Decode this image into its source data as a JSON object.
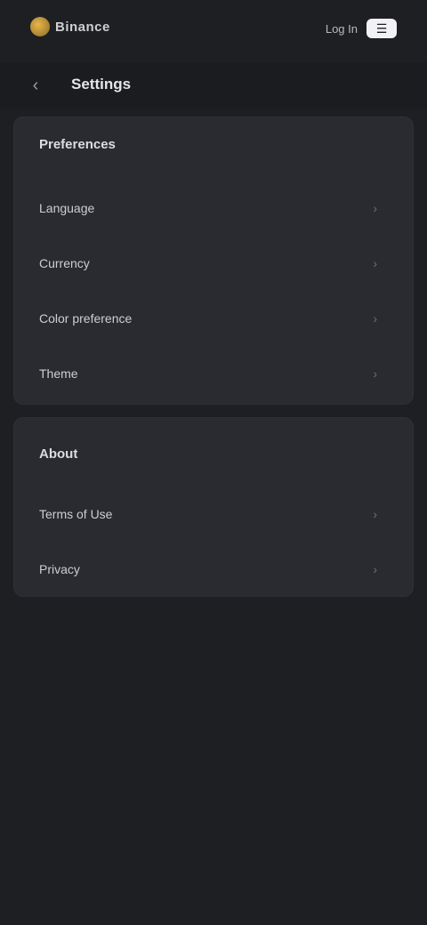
{
  "topbar": {
    "brand": "Binance",
    "login": "Log In",
    "menu_icon": "menu-icon"
  },
  "header": {
    "back_icon": "back-arrow-icon",
    "title": "Settings"
  },
  "sections": [
    {
      "title": "Preferences",
      "items": [
        {
          "label": "Language"
        },
        {
          "label": "Currency"
        },
        {
          "label": "Color preference"
        },
        {
          "label": "Theme"
        }
      ]
    },
    {
      "title": "About",
      "items": [
        {
          "label": "Terms of Use"
        },
        {
          "label": "Privacy"
        }
      ]
    }
  ],
  "footer": {
    "line1": "",
    "line2": "",
    "line3": ""
  },
  "colors": {
    "background": "#1e1f23",
    "card": "#2a2b31",
    "brand_accent": "#e8b64a"
  }
}
